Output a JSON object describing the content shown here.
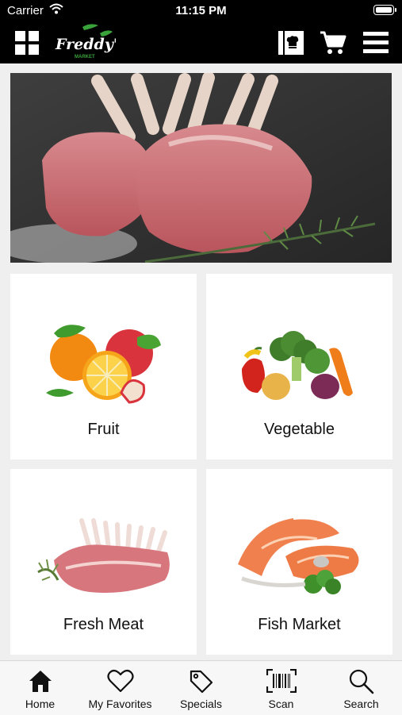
{
  "status_bar": {
    "carrier": "Carrier",
    "time": "11:15 PM"
  },
  "nav": {
    "logo_text": "Freddy's",
    "logo_subtext": "MARKET",
    "icons": [
      "grid-menu-icon",
      "chef-hat-book-icon",
      "cart-icon",
      "hamburger-menu-icon"
    ]
  },
  "categories": [
    {
      "label": "Fruit",
      "icon": "fruit-image"
    },
    {
      "label": "Vegetable",
      "icon": "vegetable-image"
    },
    {
      "label": "Fresh Meat",
      "icon": "fresh-meat-image"
    },
    {
      "label": "Fish Market",
      "icon": "fish-market-image"
    }
  ],
  "tabs": [
    {
      "label": "Home",
      "icon": "home-icon"
    },
    {
      "label": "My Favorites",
      "icon": "heart-icon"
    },
    {
      "label": "Specials",
      "icon": "tag-icon"
    },
    {
      "label": "Scan",
      "icon": "barcode-icon"
    },
    {
      "label": "Search",
      "icon": "search-icon"
    }
  ],
  "colors": {
    "bar": "#000000",
    "logo_green": "#3aa23a",
    "tab_bg": "#f7f7f7",
    "page_bg": "#efefef"
  }
}
